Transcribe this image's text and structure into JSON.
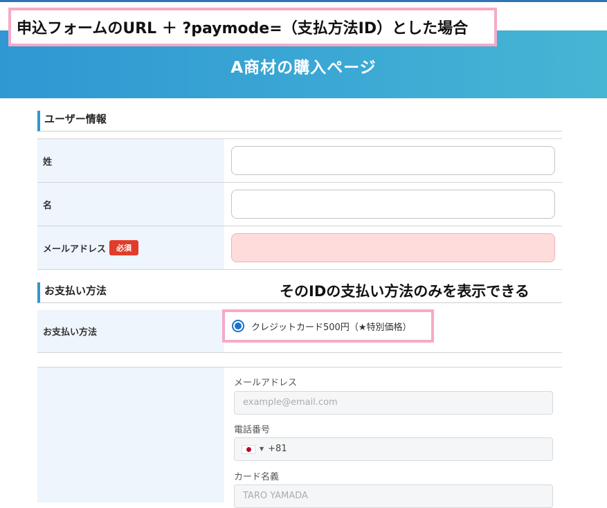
{
  "callout": {
    "text": "申込フォームのURL ＋ ?paymode=（支払方法ID）とした場合"
  },
  "page": {
    "title": "A商材の購入ページ"
  },
  "user_section": {
    "heading": "ユーザー情報",
    "rows": [
      {
        "label": "姓"
      },
      {
        "label": "名"
      },
      {
        "label": "メールアドレス",
        "badge": "必須"
      }
    ]
  },
  "payment_section": {
    "heading": "お支払い方法",
    "note": "そのIDの支払い方法のみを表示できる",
    "row_label": "お支払い方法",
    "option_label": "クレジットカード500円（★特別価格）"
  },
  "card_form": {
    "email_label": "メールアドレス",
    "email_placeholder": "example@email.com",
    "phone_label": "電話番号",
    "phone_code": "+81",
    "name_label": "カード名義",
    "name_placeholder": "TARO YAMADA"
  },
  "colors": {
    "accent": "#2f97d3",
    "required_badge": "#e23c2a",
    "highlight_border": "#f6a9c8",
    "required_field_bg": "#ffdcdc",
    "label_bg": "#eef5fc"
  }
}
